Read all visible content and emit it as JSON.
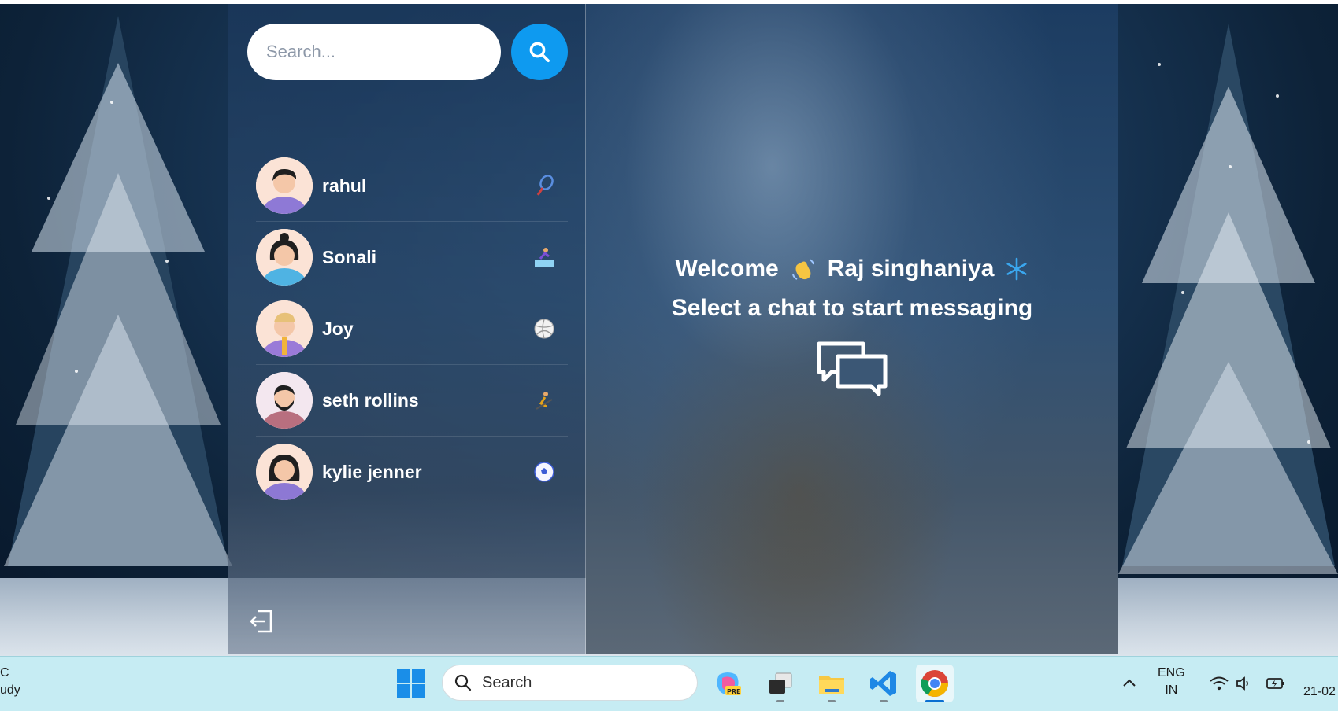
{
  "search": {
    "placeholder": "Search..."
  },
  "conversations": [
    {
      "name": "rahul",
      "emoji": "tennis-racket",
      "avatar_color": "#8e79d6"
    },
    {
      "name": "Sonali",
      "emoji": "snowboarder",
      "avatar_color": "#4fb3e3"
    },
    {
      "name": "Joy",
      "emoji": "volleyball",
      "avatar_color": "#9a7ad8"
    },
    {
      "name": "seth rollins",
      "emoji": "skier",
      "avatar_color": "#b86f7f"
    },
    {
      "name": "kylie jenner",
      "emoji": "soccer-ball",
      "avatar_color": "#8d78d4"
    }
  ],
  "welcome": {
    "greeting": "Welcome",
    "user_name": "Raj singhaniya",
    "wave_icon": "waving-hand-icon",
    "snow_icon": "snowflake-icon",
    "prompt": "Select a chat to start messaging"
  },
  "taskbar": {
    "weather_line1": "C",
    "weather_line2": "udy",
    "search_label": "Search",
    "apps": [
      "copilot-pre",
      "task-view",
      "file-explorer",
      "vs-code",
      "chrome"
    ],
    "lang_line1": "ENG",
    "lang_line2": "IN",
    "date": "21-02"
  },
  "colors": {
    "accent": "#0e9af0",
    "taskbar": "#c6ecf3"
  }
}
